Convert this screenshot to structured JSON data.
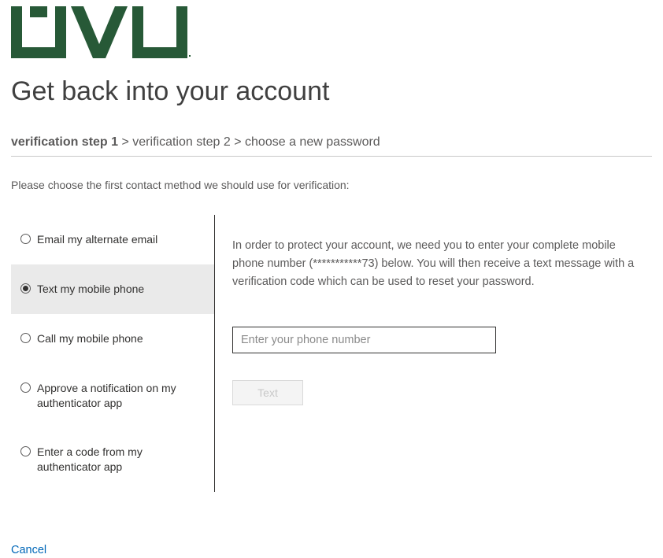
{
  "colors": {
    "brand_green": "#275937",
    "link_blue": "#0067b8"
  },
  "page": {
    "title": "Get back into your account",
    "instruction": "Please choose the first contact method we should use for verification:"
  },
  "breadcrumb": {
    "step1": "verification step 1",
    "sep1": " > ",
    "step2": "verification step 2",
    "sep2": " > ",
    "step3": "choose a new password"
  },
  "methods": {
    "option0": "Email my alternate email",
    "option1": "Text my mobile phone",
    "option2": "Call my mobile phone",
    "option3": "Approve a notification on my authenticator app",
    "option4": "Enter a code from my authenticator app",
    "selected_index": 1
  },
  "right": {
    "description": "In order to protect your account, we need you to enter your complete mobile phone number (***********73) below. You will then receive a text message with a verification code which can be used to reset your password.",
    "phone_placeholder": "Enter your phone number",
    "phone_value": "",
    "button_label": "Text"
  },
  "footer": {
    "cancel": "Cancel"
  }
}
